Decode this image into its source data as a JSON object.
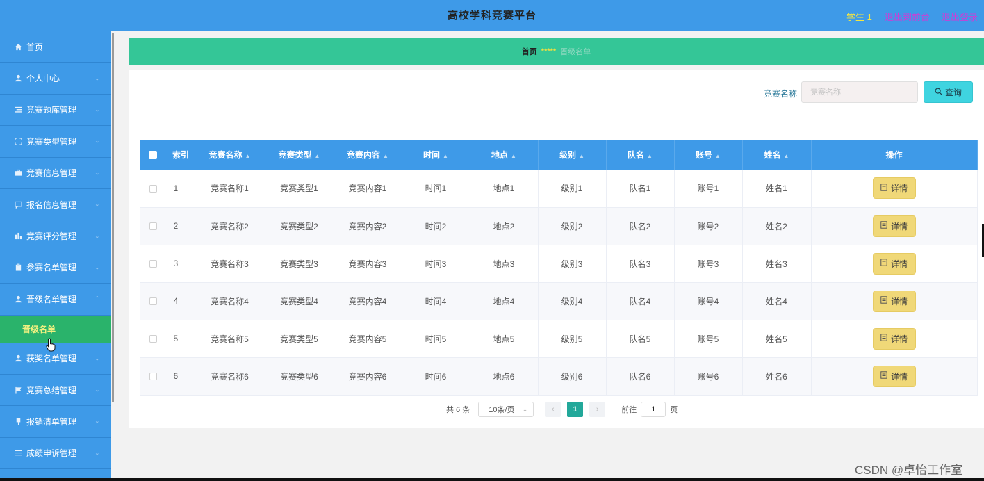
{
  "header": {
    "title": "高校学科竞赛平台",
    "user": "学生 1",
    "back_link": "退出到前台",
    "logout_link": "退出登录"
  },
  "sidebar": {
    "items": [
      {
        "label": "首页",
        "icon": "home-icon",
        "arrow": false
      },
      {
        "label": "个人中心",
        "icon": "user-icon",
        "arrow": true
      },
      {
        "label": "竞赛题库管理",
        "icon": "list-icon",
        "arrow": true
      },
      {
        "label": "竞赛类型管理",
        "icon": "frame-icon",
        "arrow": true
      },
      {
        "label": "竞赛信息管理",
        "icon": "briefcase-icon",
        "arrow": true
      },
      {
        "label": "报名信息管理",
        "icon": "chat-icon",
        "arrow": true
      },
      {
        "label": "竞赛评分管理",
        "icon": "bar-chart-icon",
        "arrow": true
      },
      {
        "label": "参赛名单管理",
        "icon": "clipboard-icon",
        "arrow": true
      },
      {
        "label": "晋级名单管理",
        "icon": "user-icon",
        "arrow": true,
        "expanded": true
      },
      {
        "label": "获奖名单管理",
        "icon": "user-icon",
        "arrow": true
      },
      {
        "label": "竞赛总结管理",
        "icon": "flag-icon",
        "arrow": true
      },
      {
        "label": "报销清单管理",
        "icon": "pin-icon",
        "arrow": true
      },
      {
        "label": "成绩申诉管理",
        "icon": "menu-icon",
        "arrow": true
      }
    ],
    "submenu_active": "晋级名单"
  },
  "breadcrumb": {
    "home": "首页",
    "separator": "*****",
    "current": "晋级名单"
  },
  "search": {
    "label": "竞赛名称",
    "placeholder": "竞赛名称",
    "button": "查询"
  },
  "table": {
    "columns": [
      "索引",
      "竞赛名称",
      "竞赛类型",
      "竞赛内容",
      "时间",
      "地点",
      "级别",
      "队名",
      "账号",
      "姓名",
      "操作"
    ],
    "rows": [
      {
        "index": "1",
        "name": "竞赛名称1",
        "type": "竞赛类型1",
        "content": "竞赛内容1",
        "time": "时间1",
        "place": "地点1",
        "level": "级别1",
        "team": "队名1",
        "account": "账号1",
        "person": "姓名1"
      },
      {
        "index": "2",
        "name": "竞赛名称2",
        "type": "竞赛类型2",
        "content": "竞赛内容2",
        "time": "时间2",
        "place": "地点2",
        "level": "级别2",
        "team": "队名2",
        "account": "账号2",
        "person": "姓名2"
      },
      {
        "index": "3",
        "name": "竞赛名称3",
        "type": "竞赛类型3",
        "content": "竞赛内容3",
        "time": "时间3",
        "place": "地点3",
        "level": "级别3",
        "team": "队名3",
        "account": "账号3",
        "person": "姓名3"
      },
      {
        "index": "4",
        "name": "竞赛名称4",
        "type": "竞赛类型4",
        "content": "竞赛内容4",
        "time": "时间4",
        "place": "地点4",
        "level": "级别4",
        "team": "队名4",
        "account": "账号4",
        "person": "姓名4"
      },
      {
        "index": "5",
        "name": "竞赛名称5",
        "type": "竞赛类型5",
        "content": "竞赛内容5",
        "time": "时间5",
        "place": "地点5",
        "level": "级别5",
        "team": "队名5",
        "account": "账号5",
        "person": "姓名5"
      },
      {
        "index": "6",
        "name": "竞赛名称6",
        "type": "竞赛类型6",
        "content": "竞赛内容6",
        "time": "时间6",
        "place": "地点6",
        "level": "级别6",
        "team": "队名6",
        "account": "账号6",
        "person": "姓名6"
      }
    ],
    "detail_button": "详情"
  },
  "pagination": {
    "total": "共 6 条",
    "page_size": "10条/页",
    "current_page": "1",
    "goto_prefix": "前往",
    "goto_value": "1",
    "goto_suffix": "页"
  },
  "watermark": "CSDN @卓怡工作室",
  "colors": {
    "primary": "#3e9ae8",
    "breadcrumb_bg": "#34c697",
    "submenu_active": "#2ab36b",
    "search_button": "#3fd4e0",
    "detail_button": "#f0d878",
    "page_active": "#22a89a"
  }
}
